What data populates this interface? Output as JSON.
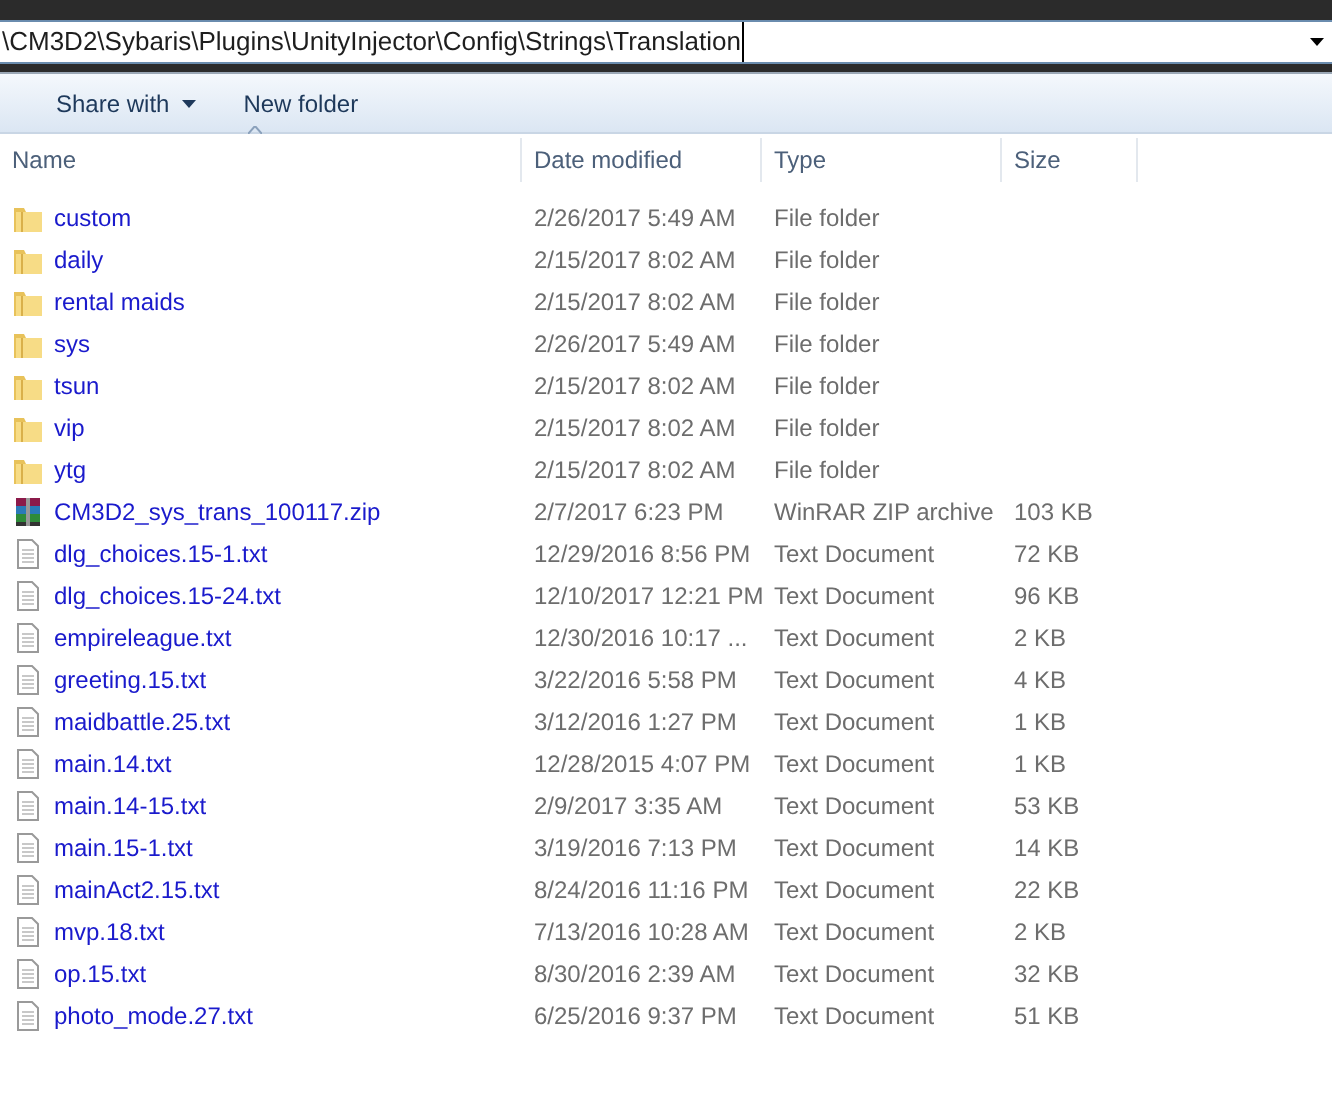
{
  "address_bar": {
    "path": "\\CM3D2\\Sybaris\\Plugins\\UnityInjector\\Config\\Strings\\Translation"
  },
  "toolbar": [
    {
      "label": "Share with",
      "dropdown": true
    },
    {
      "label": "New folder",
      "dropdown": false
    }
  ],
  "columns": [
    {
      "label": "Name",
      "sorted": true
    },
    {
      "label": "Date modified",
      "sorted": false
    },
    {
      "label": "Type",
      "sorted": false
    },
    {
      "label": "Size",
      "sorted": false
    }
  ],
  "files": [
    {
      "kind": "folder",
      "name": "custom",
      "date": "2/26/2017 5:49 AM",
      "type": "File folder"
    },
    {
      "kind": "folder",
      "name": "daily",
      "date": "2/15/2017 8:02 AM",
      "type": "File folder"
    },
    {
      "kind": "folder",
      "name": "rental maids",
      "date": "2/15/2017 8:02 AM",
      "type": "File folder"
    },
    {
      "kind": "folder",
      "name": "sys",
      "date": "2/26/2017 5:49 AM",
      "type": "File folder"
    },
    {
      "kind": "folder",
      "name": "tsun",
      "date": "2/15/2017 8:02 AM",
      "type": "File folder"
    },
    {
      "kind": "folder",
      "name": "vip",
      "date": "2/15/2017 8:02 AM",
      "type": "File folder"
    },
    {
      "kind": "folder",
      "name": "ytg",
      "date": "2/15/2017 8:02 AM",
      "type": "File folder"
    },
    {
      "kind": "zip",
      "name": "CM3D2_sys_trans_100117.zip",
      "date": "2/7/2017 6:23 PM",
      "type": "WinRAR ZIP archive",
      "size": "103 KB"
    },
    {
      "kind": "text",
      "name": "dlg_choices.15-1.txt",
      "date": "12/29/2016 8:56 PM",
      "type": "Text Document",
      "size": "72 KB"
    },
    {
      "kind": "text",
      "name": "dlg_choices.15-24.txt",
      "date": "12/10/2017 12:21 PM",
      "type": "Text Document",
      "size": "96 KB"
    },
    {
      "kind": "text",
      "name": "empireleague.txt",
      "date": "12/30/2016 10:17 ...",
      "type": "Text Document",
      "size": "2 KB"
    },
    {
      "kind": "text",
      "name": "greeting.15.txt",
      "date": "3/22/2016 5:58 PM",
      "type": "Text Document",
      "size": "4 KB"
    },
    {
      "kind": "text",
      "name": "maidbattle.25.txt",
      "date": "3/12/2016 1:27 PM",
      "type": "Text Document",
      "size": "1 KB"
    },
    {
      "kind": "text",
      "name": "main.14.txt",
      "date": "12/28/2015 4:07 PM",
      "type": "Text Document",
      "size": "1 KB"
    },
    {
      "kind": "text",
      "name": "main.14-15.txt",
      "date": "2/9/2017 3:35 AM",
      "type": "Text Document",
      "size": "53 KB"
    },
    {
      "kind": "text",
      "name": "main.15-1.txt",
      "date": "3/19/2016 7:13 PM",
      "type": "Text Document",
      "size": "14 KB"
    },
    {
      "kind": "text",
      "name": "mainAct2.15.txt",
      "date": "8/24/2016 11:16 PM",
      "type": "Text Document",
      "size": "22 KB"
    },
    {
      "kind": "text",
      "name": "mvp.18.txt",
      "date": "7/13/2016 10:28 AM",
      "type": "Text Document",
      "size": "2 KB"
    },
    {
      "kind": "text",
      "name": "op.15.txt",
      "date": "8/30/2016 2:39 AM",
      "type": "Text Document",
      "size": "32 KB"
    },
    {
      "kind": "text",
      "name": "photo_mode.27.txt",
      "date": "6/25/2016 9:37 PM",
      "type": "Text Document",
      "size": "51 KB"
    }
  ]
}
